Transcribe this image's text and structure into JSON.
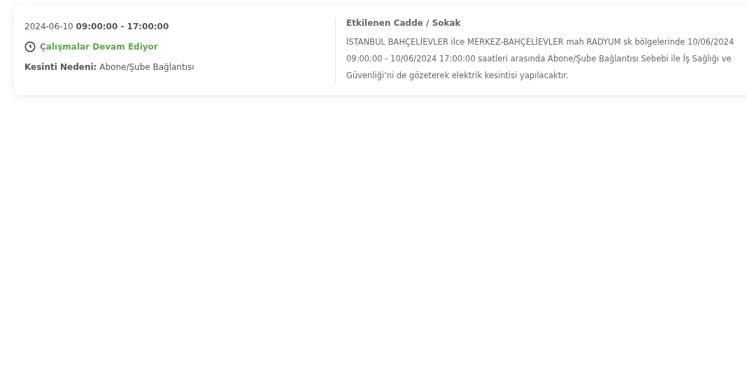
{
  "outage": {
    "date_time": "2024-06-10 **09:00:00 - 17:00:00**",
    "status": {
      "label": "Çalışmalar Devam Ediyor",
      "color": "#5ba84a"
    },
    "reason": "**Kesinti Nedeni:** Abone/Şube Bağlantısı",
    "affected_title": "Etkilenen Cadde / Sokak",
    "affected_text": "İSTANBUL BAHÇELİEVLER ilce MERKEZ-BAHÇELİEVLER mah RADYUM sk bölgelerinde 10/06/2024 09:00:00 - 10/06/2024 17:00:00 saatleri arasında Abone/Şube Bağlantısı Sebebi ile İş Sağlığı ve Güvenliği’ni de gözeterek elektrik kesintisi yapılacaktır."
  }
}
